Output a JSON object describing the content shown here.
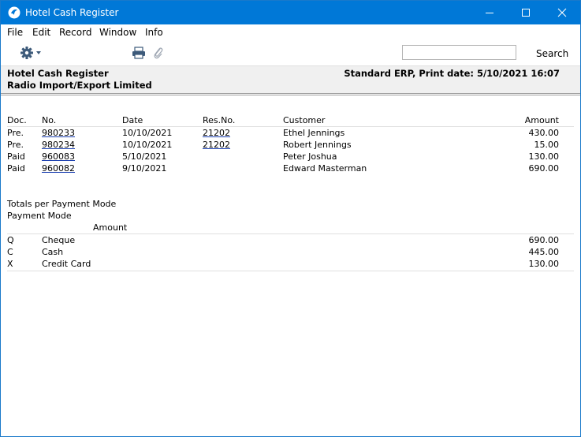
{
  "window": {
    "title": "Hotel Cash Register",
    "icons": {
      "app": "app-logo-icon",
      "minimize": "minimize-icon",
      "maximize": "maximize-icon",
      "close": "close-icon"
    }
  },
  "menu": [
    "File",
    "Edit",
    "Record",
    "Window",
    "Info"
  ],
  "toolbar": {
    "search_value": "",
    "search_label": "Search",
    "icons": {
      "settings": "gear-icon",
      "print": "printer-icon",
      "attach": "paperclip-icon"
    }
  },
  "report": {
    "title": "Hotel Cash Register",
    "company": "Radio Import/Export Limited",
    "print_info": "Standard ERP, Print date: 5/10/2021 16:07",
    "columns": {
      "doc": "Doc.",
      "no": "No.",
      "date": "Date",
      "resno": "Res.No.",
      "customer": "Customer",
      "amount": "Amount"
    },
    "rows": [
      {
        "doc": "Pre.",
        "no": "980233",
        "date": "10/10/2021",
        "resno": "21202",
        "customer": "Ethel Jennings",
        "amount": "430.00"
      },
      {
        "doc": "Pre.",
        "no": "980234",
        "date": "10/10/2021",
        "resno": "21202",
        "customer": "Robert Jennings",
        "amount": "15.00"
      },
      {
        "doc": "Paid",
        "no": "960083",
        "date": "5/10/2021",
        "resno": "",
        "customer": "Peter Joshua",
        "amount": "130.00"
      },
      {
        "doc": "Paid",
        "no": "960082",
        "date": "9/10/2021",
        "resno": "",
        "customer": "Edward Masterman",
        "amount": "690.00"
      }
    ],
    "totals": {
      "heading": "Totals per Payment Mode",
      "subheading": "Payment Mode",
      "amount_header": "Amount",
      "rows": [
        {
          "code": "Q",
          "name": "Cheque",
          "amount": "690.00"
        },
        {
          "code": "C",
          "name": "Cash",
          "amount": "445.00"
        },
        {
          "code": "X",
          "name": "Credit Card",
          "amount": "130.00"
        }
      ]
    }
  },
  "colors": {
    "titlebar": "#0078d7",
    "link_underline": "#1a3fb0",
    "header_bg": "#f0f0f0"
  }
}
